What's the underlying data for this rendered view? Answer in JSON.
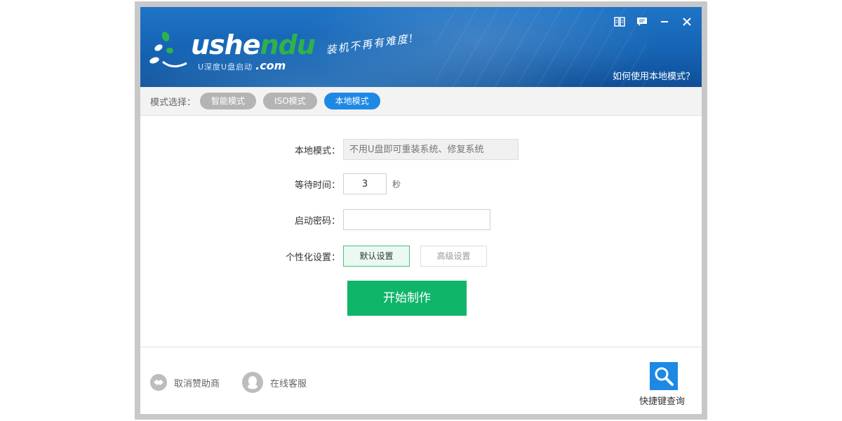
{
  "header": {
    "logo_word_a": "ushe",
    "logo_word_b": "ndu",
    "logo_sub": "U深度U盘启动",
    "logo_com": ".com",
    "slogan": "装机不再有难度!",
    "help_link": "如何使用本地模式？"
  },
  "mode_bar": {
    "label": "模式选择：",
    "modes": [
      "智能模式",
      "ISO模式",
      "本地模式"
    ],
    "active": "本地模式"
  },
  "form": {
    "local_mode_label": "本地模式：",
    "local_mode_placeholder": "不用U盘即可重装系统、修复系统",
    "wait_label": "等待时间：",
    "wait_value": "3",
    "wait_unit": "秒",
    "password_label": "启动密码：",
    "password_value": "",
    "personalize_label": "个性化设置：",
    "default_settings": "默认设置",
    "advanced_settings": "高级设置",
    "start_button": "开始制作"
  },
  "footer": {
    "sponsor_cancel": "取消赞助商",
    "online_service": "在线客服",
    "quick_lookup": "快捷键查询"
  },
  "colors": {
    "header_blue": "#1563b3",
    "active_pill": "#1e88e5",
    "start_green": "#0fb569",
    "logo_green": "#2fb24a"
  },
  "icons": [
    "book-icon",
    "chat-icon",
    "minimize-icon",
    "close-icon",
    "handshake-icon",
    "qq-icon",
    "search-icon"
  ]
}
